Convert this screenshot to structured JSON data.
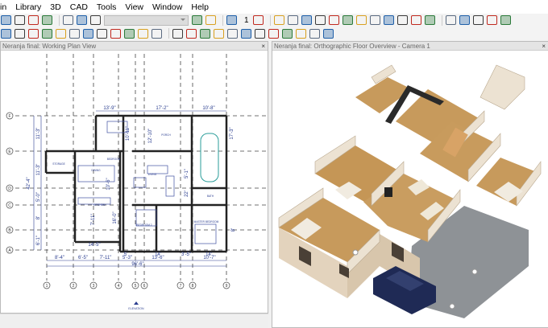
{
  "menu": [
    "in",
    "Library",
    "3D",
    "CAD",
    "Tools",
    "View",
    "Window",
    "Help"
  ],
  "toolbar1": {
    "icons": [
      "undo-icon",
      "redo-icon",
      "plan-icon",
      "help-icon",
      "|",
      "edit-layer-icon",
      "save-view-icon",
      "save-view-red-icon",
      "combo",
      "check-icon",
      "tools-icon",
      "|",
      "down-floor-icon",
      "floor-num",
      "up-floor-icon",
      "|",
      "home-icon",
      "camera-icon",
      "elevation-icon",
      "perspective-icon",
      "floor-overview-icon",
      "dollhouse-icon",
      "light-icon",
      "paint-icon",
      "eyedropper-icon",
      "material-icon",
      "delete-surface-icon",
      "pencil-icon",
      "|",
      "tile-horiz-icon",
      "tile-vert-icon",
      "window-icon",
      "folder-icon",
      "layout-icon"
    ],
    "floor_number": "1",
    "colors": {
      "accent": "#1f5fa8",
      "red": "#c0281e"
    }
  },
  "toolbar2": {
    "icons": [
      "wall-icon",
      "railing-icon",
      "cabinet-icon",
      "stairs-icon",
      "roof-icon",
      "door-icon",
      "window-tool-icon",
      "fireplace-icon",
      "shape-icon",
      "roof-plane-icon",
      "dormer-icon",
      "box-icon",
      "|",
      "pencil-tool-icon",
      "dimension-icon",
      "text-icon",
      "callout-icon",
      "x-line-icon",
      "line-icon",
      "arc-icon",
      "circle-icon",
      "rectangle-icon",
      "spline-icon",
      "revision-icon",
      "marker-icon"
    ]
  },
  "left_panel": {
    "title": "Neranja final: Working Plan View",
    "close": "×"
  },
  "right_panel": {
    "title": "Neranja final: Orthographic Floor Overview - Camera 1",
    "close": "×"
  },
  "plan": {
    "row_labels": [
      "F",
      "E",
      "D",
      "C",
      "B",
      "A"
    ],
    "col_labels": [
      "1",
      "2",
      "3",
      "4",
      "5",
      "6",
      "7",
      "8",
      "9"
    ],
    "left_dims": [
      "11'-3\"",
      "11'-3\"",
      "5'-0\"",
      "8'",
      "6'-1\""
    ],
    "left_total": "42'-4\"",
    "top_dims": [
      "13'-9\"",
      "17'-2\"",
      "10'-8\""
    ],
    "bottom_dims": [
      "8'-4\"",
      "6'-5\"",
      "7'-11\"",
      "5'-3\"",
      "13'-6\"",
      "10'-7\""
    ],
    "bottom_total": "96'-6\"",
    "inner_dims": [
      "14'-5\"",
      "5'",
      "14'",
      "3'-5\"",
      "14'",
      "10'-11\"",
      "12'-10\"",
      "10'-6\"",
      "7'-11\"",
      "16'-0\"",
      "5'-1\"",
      "22'",
      "17'-3\"",
      "8'"
    ],
    "rooms": [
      "PORCH",
      "LIVING",
      "DINING",
      "KITCHEN",
      "STORAGE",
      "BEDROOM 2",
      "MASTER BEDROOM",
      "BATH",
      "BEDROOM"
    ],
    "north_label": "ELEVATION"
  }
}
